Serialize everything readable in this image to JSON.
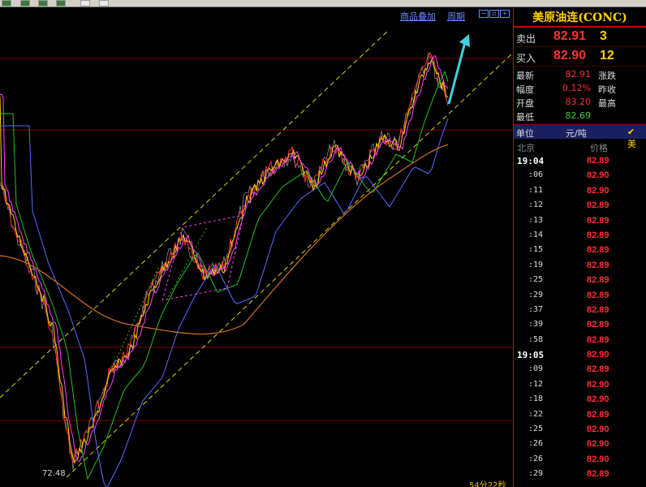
{
  "toolbar": {
    "buttons": [
      "btn-1",
      "btn-2",
      "btn-3",
      "btn-4",
      "btn-5",
      "btn-6"
    ]
  },
  "chart": {
    "overlay_link": "商品叠加",
    "period_link": "周期",
    "low_label": "72.48",
    "timer": "54分22秒",
    "colors": {
      "line_red": "#ff3030",
      "line_yellow": "#ffd000",
      "line_pink": "#ff40ff",
      "line_green": "#20c020",
      "line_blue": "#5a6aff",
      "line_orange": "#d07020",
      "channel": "#d8d800",
      "arrow": "#40d0e0",
      "grid": "#800000"
    }
  },
  "panel": {
    "title": "美原油连(CONC)",
    "sell": {
      "label": "卖出",
      "price": "82.91",
      "volume": "3"
    },
    "buy": {
      "label": "买入",
      "price": "82.90",
      "volume": "12"
    },
    "stats": [
      {
        "label": "最新",
        "value": "82.91",
        "label2": "涨跌",
        "color": "red"
      },
      {
        "label": "幅度",
        "value": "0.12%",
        "label2": "昨收",
        "color": "red"
      },
      {
        "label": "开盘",
        "value": "83.20",
        "label2": "最高",
        "color": "red"
      },
      {
        "label": "最低",
        "value": "82.69",
        "label2": "",
        "color": "green"
      }
    ],
    "unit_label": "单位",
    "unit_value": "元/吨",
    "unit_check": "✔ 美",
    "tick_header_time": "北京",
    "tick_header_price": "价格",
    "ticks": [
      {
        "time": "19:04",
        "price": "82.89",
        "bold": true
      },
      {
        "time": ":06",
        "price": "82.90"
      },
      {
        "time": ":11",
        "price": "82.90"
      },
      {
        "time": ":12",
        "price": "82.89"
      },
      {
        "time": ":13",
        "price": "82.89"
      },
      {
        "time": ":14",
        "price": "82.89"
      },
      {
        "time": ":15",
        "price": "82.89"
      },
      {
        "time": ":19",
        "price": "82.89"
      },
      {
        "time": ":25",
        "price": "82.89"
      },
      {
        "time": ":29",
        "price": "82.89"
      },
      {
        "time": ":37",
        "price": "82.89"
      },
      {
        "time": ":39",
        "price": "82.89"
      },
      {
        "time": ":58",
        "price": "82.89"
      },
      {
        "time": "19:05",
        "price": "82.90",
        "bold": true
      },
      {
        "time": ":09",
        "price": "82.89"
      },
      {
        "time": ":12",
        "price": "82.90"
      },
      {
        "time": ":18",
        "price": "82.90"
      },
      {
        "time": ":22",
        "price": "82.89"
      },
      {
        "time": ":25",
        "price": "82.90"
      },
      {
        "time": ":26",
        "price": "82.90"
      },
      {
        "time": ":26",
        "price": "82.90"
      },
      {
        "time": ":29",
        "price": "82.89"
      }
    ]
  }
}
